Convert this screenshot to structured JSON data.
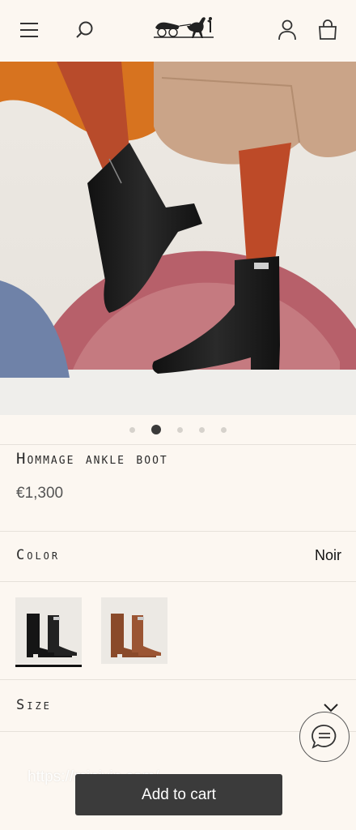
{
  "header": {
    "menu_icon": "menu-icon",
    "search_icon": "search-icon",
    "logo": "hermes-carriage-logo",
    "account_icon": "account-icon",
    "bag_icon": "shopping-bag-icon"
  },
  "carousel": {
    "count": 5,
    "active_index": 1
  },
  "product": {
    "title": "Hommage ankle boot",
    "price": "€1,300"
  },
  "color": {
    "label": "Color",
    "value": "Noir",
    "swatches": [
      {
        "name": "Noir",
        "color": "#1c1c1c",
        "selected": true
      },
      {
        "name": "Brown",
        "color": "#8a4a2a",
        "selected": false
      }
    ]
  },
  "size": {
    "label": "Size"
  },
  "chat": {
    "icon": "chat-icon"
  },
  "footer": {
    "watermark": "https://minivip.com/",
    "add_to_cart": "Add to cart"
  },
  "colors": {
    "background": "#fcf7f1",
    "cta": "#3b3b3b",
    "active_dot": "#3a3a3a"
  }
}
